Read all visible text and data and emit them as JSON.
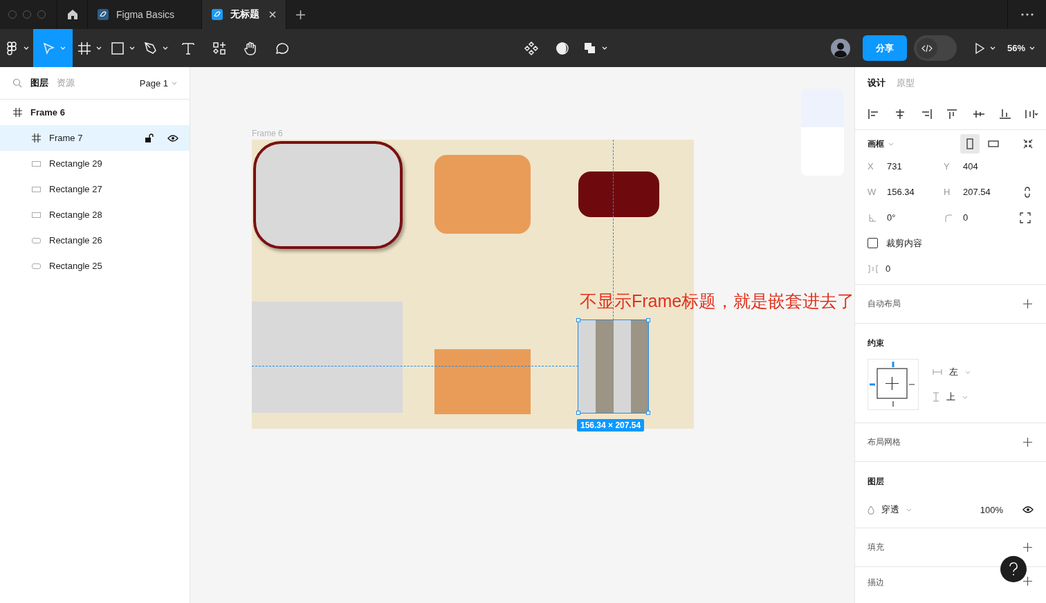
{
  "tabs": [
    {
      "label": "Figma Basics",
      "selected": false
    },
    {
      "label": "无标题",
      "selected": true
    }
  ],
  "tools": [
    {
      "kind": "main-menu",
      "selected": false,
      "dropdown": true
    },
    {
      "kind": "move",
      "selected": true,
      "dropdown": true
    },
    {
      "kind": "frame",
      "selected": false,
      "dropdown": true
    },
    {
      "kind": "shape",
      "selected": false,
      "dropdown": true
    },
    {
      "kind": "pen",
      "selected": false,
      "dropdown": true
    },
    {
      "kind": "text",
      "selected": false,
      "dropdown": false
    },
    {
      "kind": "resources",
      "selected": false,
      "dropdown": false
    },
    {
      "kind": "hand",
      "selected": false,
      "dropdown": false
    },
    {
      "kind": "comment",
      "selected": false,
      "dropdown": false
    }
  ],
  "center_tools": [
    {
      "kind": "component",
      "dropdown": false
    },
    {
      "kind": "mask",
      "dropdown": false
    },
    {
      "kind": "boolean",
      "dropdown": true
    }
  ],
  "share_button": "分享",
  "dev_mode": {
    "on": false
  },
  "zoom": "56%",
  "layers_panel": {
    "tabs": [
      {
        "label": "图层",
        "selected": true
      },
      {
        "label": "资源",
        "selected": false
      }
    ],
    "page": "Page 1",
    "layers": [
      {
        "name": "Frame 6",
        "kind": "frame",
        "selected": false,
        "children": [
          {
            "name": "Frame 7",
            "kind": "frame",
            "selected": true
          },
          {
            "name": "Rectangle 29",
            "kind": "rectangle",
            "selected": false
          },
          {
            "name": "Rectangle 27",
            "kind": "rectangle",
            "selected": false
          },
          {
            "name": "Rectangle 28",
            "kind": "rectangle",
            "selected": false
          },
          {
            "name": "Rectangle 26",
            "kind": "rounded",
            "selected": false
          },
          {
            "name": "Rectangle 25",
            "kind": "rounded",
            "selected": false
          }
        ]
      }
    ]
  },
  "canvas": {
    "frame_label": "Frame 6",
    "size_badge": "156.34 × 207.54",
    "annotation": "不显示Frame标题，就是嵌套进去了"
  },
  "design_panel": {
    "tabs": [
      {
        "label": "设计",
        "selected": true
      },
      {
        "label": "原型",
        "selected": false
      }
    ],
    "frame_section": {
      "title": "画框",
      "orientation": [
        {
          "kind": "portrait",
          "selected": true
        },
        {
          "kind": "landscape",
          "selected": false
        }
      ],
      "fields": [
        {
          "label": "X",
          "value": "731"
        },
        {
          "label": "Y",
          "value": "404"
        },
        {
          "label": "W",
          "value": "156.34"
        },
        {
          "label": "H",
          "value": "207.54"
        }
      ],
      "rotation": "0°",
      "radius": "0",
      "clip": {
        "label": "裁剪内容",
        "checked": false
      },
      "spacing": "0"
    },
    "auto_layout": "自动布局",
    "constraints": {
      "title": "约束",
      "horizontal": "左",
      "vertical": "上"
    },
    "layout_grid": "布局网格",
    "layer": {
      "title": "图层",
      "blend": "穿透",
      "opacity": "100%"
    },
    "fill": "填充",
    "stroke": "描边"
  }
}
